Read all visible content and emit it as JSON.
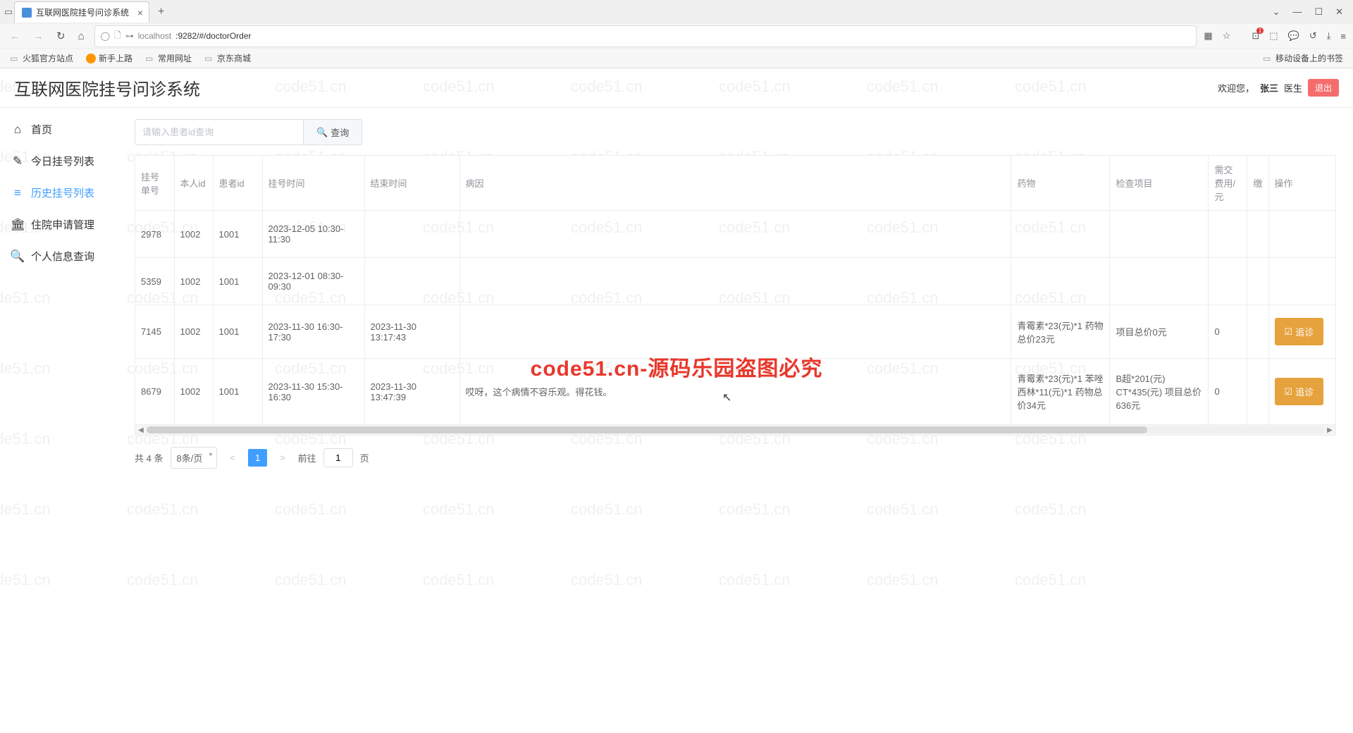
{
  "browser": {
    "tab_title": "互联网医院挂号问诊系统",
    "new_tab": "+",
    "url_prefix": "localhost",
    "url_path": ":9282/#/doctorOrder",
    "bookmarks": {
      "firefox": "火狐官方站点",
      "newbie": "新手上路",
      "common": "常用网址",
      "jd": "京东商城",
      "mobile": "移动设备上的书签"
    },
    "window": {
      "min": "—",
      "max": "☐",
      "close": "✕",
      "down": "⌄"
    }
  },
  "header": {
    "title": "互联网医院挂号问诊系统",
    "welcome": "欢迎您，",
    "user_name": "张三",
    "role": "医生",
    "logout": "退出"
  },
  "sidebar": {
    "items": [
      {
        "icon": "⌂",
        "label": "首页"
      },
      {
        "icon": "✎",
        "label": "今日挂号列表"
      },
      {
        "icon": "≡",
        "label": "历史挂号列表"
      },
      {
        "icon": "🏛",
        "label": "住院申请管理"
      },
      {
        "icon": "🔍",
        "label": "个人信息查询"
      }
    ]
  },
  "search": {
    "placeholder": "请输入患者id查询",
    "button": "查询"
  },
  "table": {
    "headers": {
      "reg_no": "挂号单号",
      "self_id": "本人id",
      "patient_id": "患者id",
      "reg_time": "挂号时间",
      "end_time": "结束时间",
      "cause": "病因",
      "medicine": "药物",
      "exam": "检查项目",
      "fee": "需交费用/元",
      "pay": "缴",
      "action": "操作"
    },
    "rows": [
      {
        "reg_no": "2978",
        "self_id": "1002",
        "patient_id": "1001",
        "reg_time": "2023-12-05 10:30-11:30",
        "end_time": "",
        "cause": "",
        "medicine": "",
        "exam": "",
        "fee": "",
        "action": ""
      },
      {
        "reg_no": "5359",
        "self_id": "1002",
        "patient_id": "1001",
        "reg_time": "2023-12-01 08:30-09:30",
        "end_time": "",
        "cause": "",
        "medicine": "",
        "exam": "",
        "fee": "",
        "action": ""
      },
      {
        "reg_no": "7145",
        "self_id": "1002",
        "patient_id": "1001",
        "reg_time": "2023-11-30 16:30-17:30",
        "end_time": "2023-11-30 13:17:43",
        "cause": "",
        "medicine": "青霉素*23(元)*1 药物总价23元",
        "exam": "项目总价0元",
        "fee": "0",
        "action": "追诊"
      },
      {
        "reg_no": "8679",
        "self_id": "1002",
        "patient_id": "1001",
        "reg_time": "2023-11-30 15:30-16:30",
        "end_time": "2023-11-30 13:47:39",
        "cause": "哎呀，这个病情不容乐观。得花钱。",
        "medicine": "青霉素*23(元)*1 苯唑西林*11(元)*1 药物总价34元",
        "exam": "B超*201(元)  CT*435(元) 项目总价636元",
        "fee": "0",
        "action": "追诊"
      }
    ]
  },
  "pagination": {
    "total_prefix": "共",
    "total": "4",
    "total_suffix": "条",
    "page_size": "8条/页",
    "current": "1",
    "goto_prefix": "前往",
    "goto_value": "1",
    "goto_suffix": "页"
  },
  "watermark": {
    "text": "code51.cn",
    "center": "code51.cn-源码乐园盗图必究"
  }
}
